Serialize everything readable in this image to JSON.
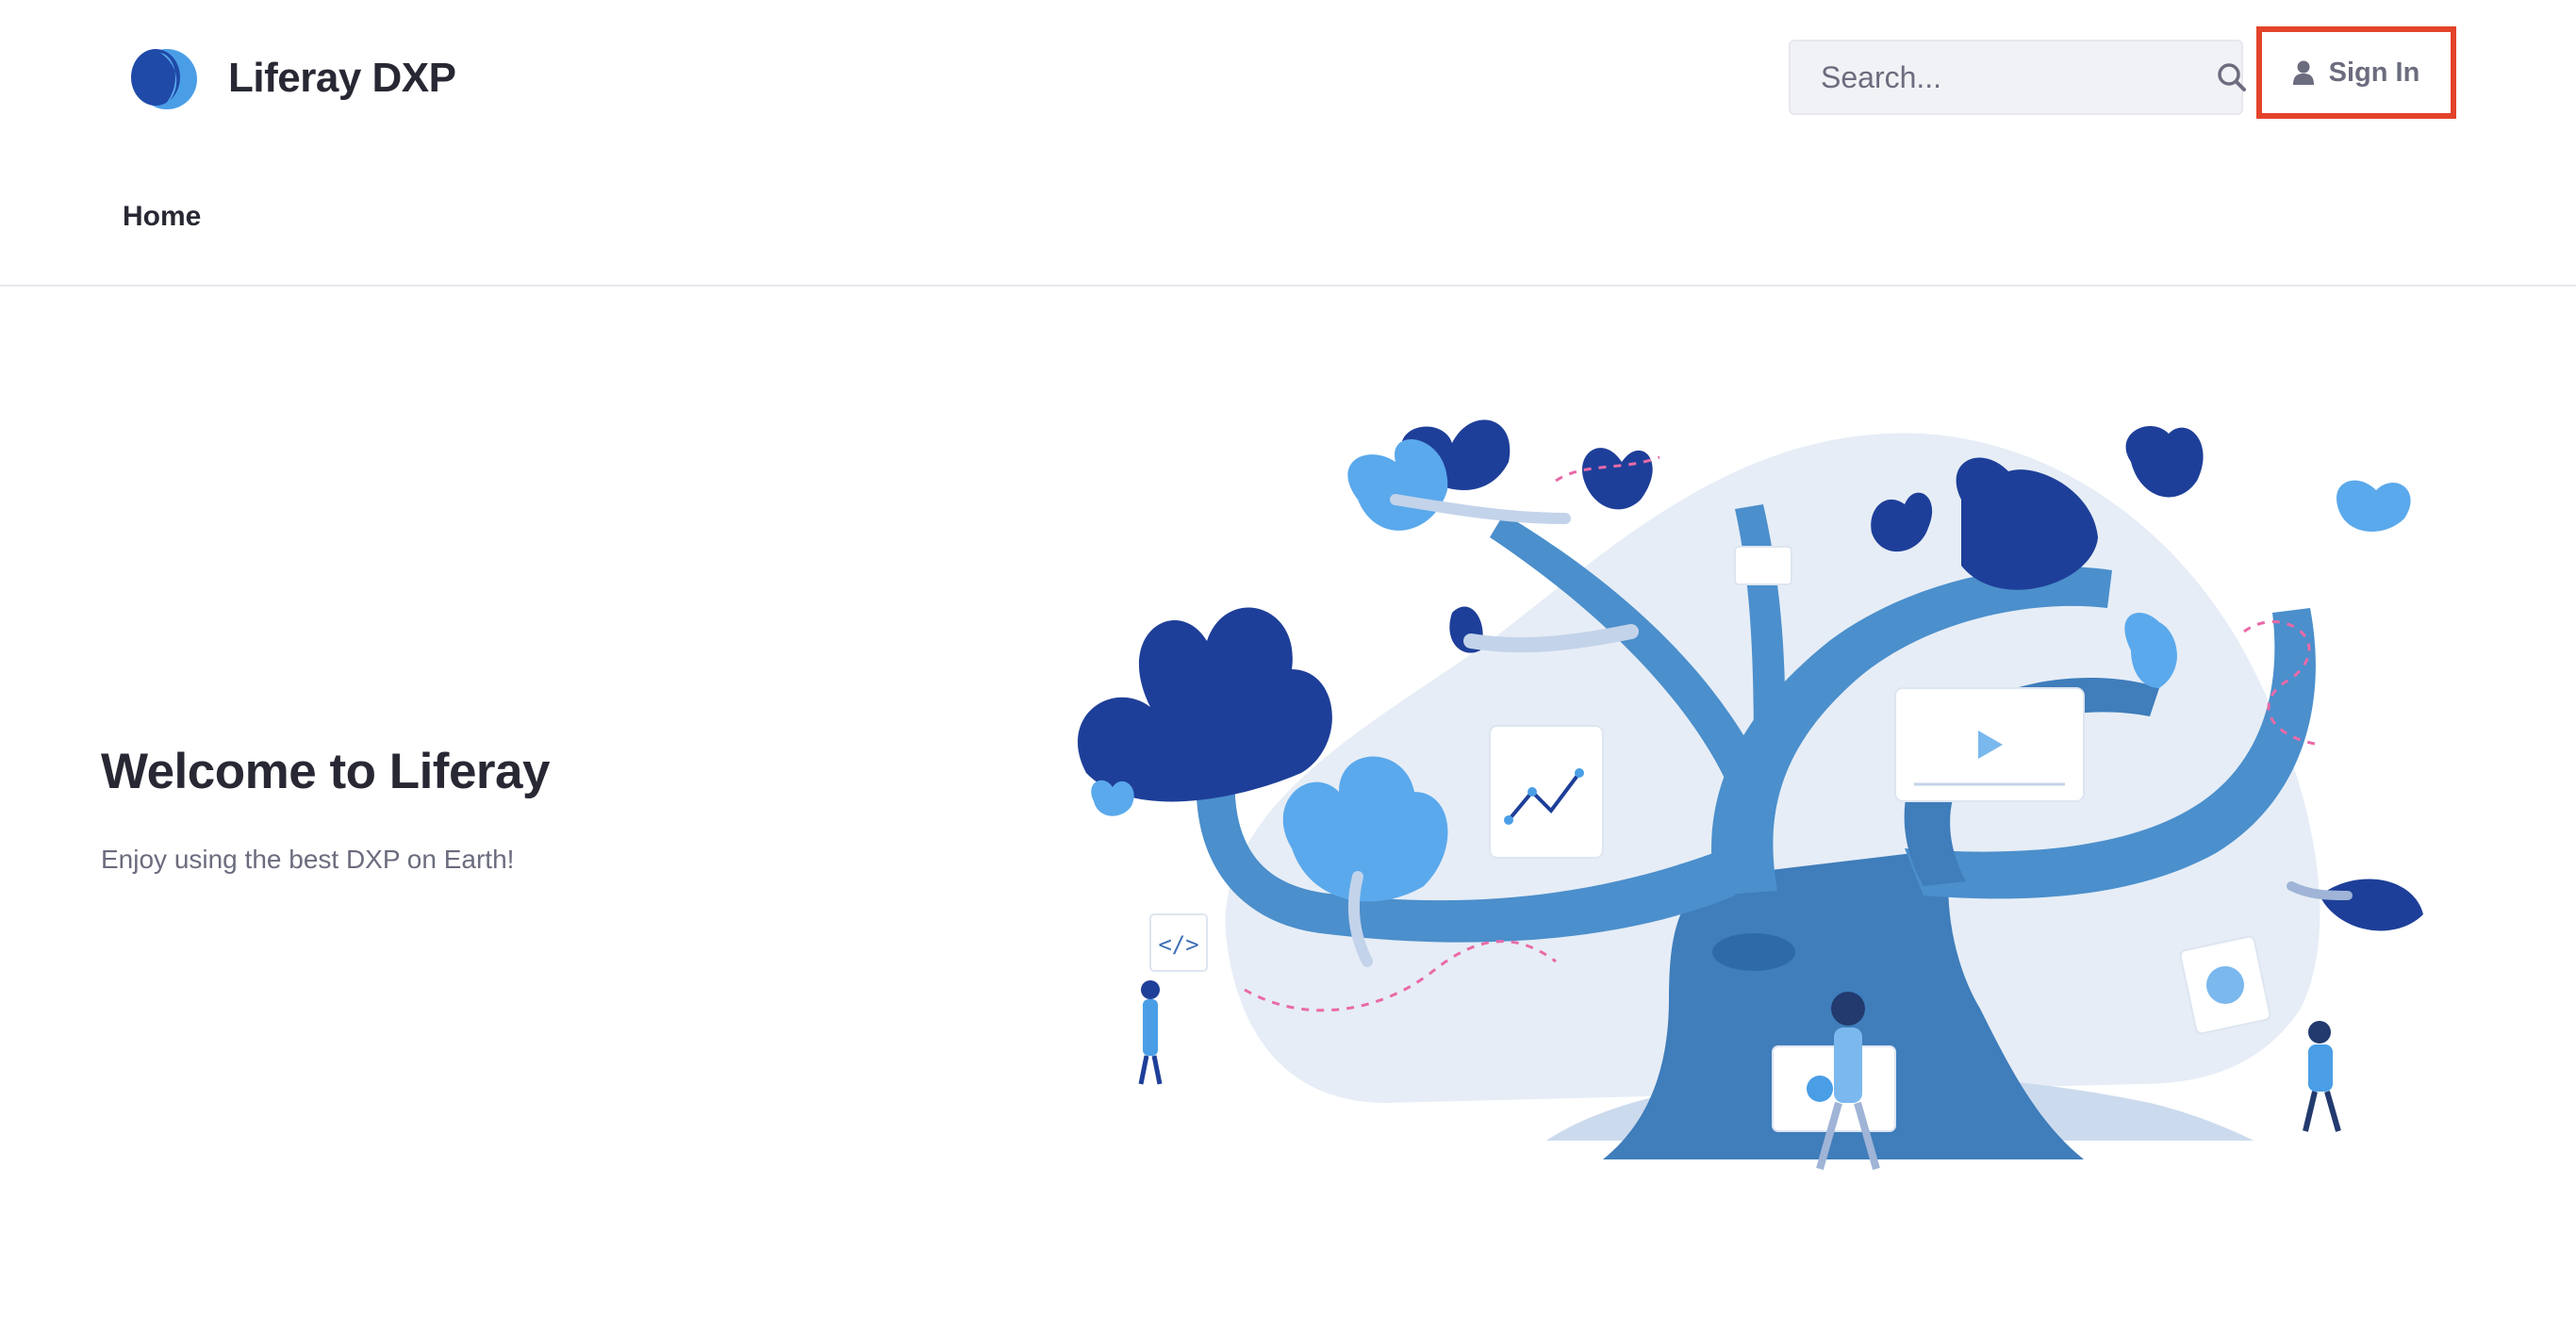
{
  "header": {
    "brand_name": "Liferay DXP",
    "search_placeholder": "Search...",
    "sign_in_label": "Sign In"
  },
  "nav": {
    "items": [
      {
        "label": "Home"
      }
    ]
  },
  "hero": {
    "title": "Welcome to Liferay",
    "subtitle": "Enjoy using the best DXP on Earth!"
  },
  "colors": {
    "brand_dark": "#1f4aa8",
    "brand_light": "#4a9ee6",
    "tree_blue": "#4b8fcc",
    "leaf_navy": "#1e3f99",
    "highlight_border": "#e3432a",
    "text_primary": "#272833",
    "text_secondary": "#6b6c7e"
  },
  "icons": {
    "logo": "liferay-logo",
    "search": "search-icon",
    "user": "user-icon"
  }
}
